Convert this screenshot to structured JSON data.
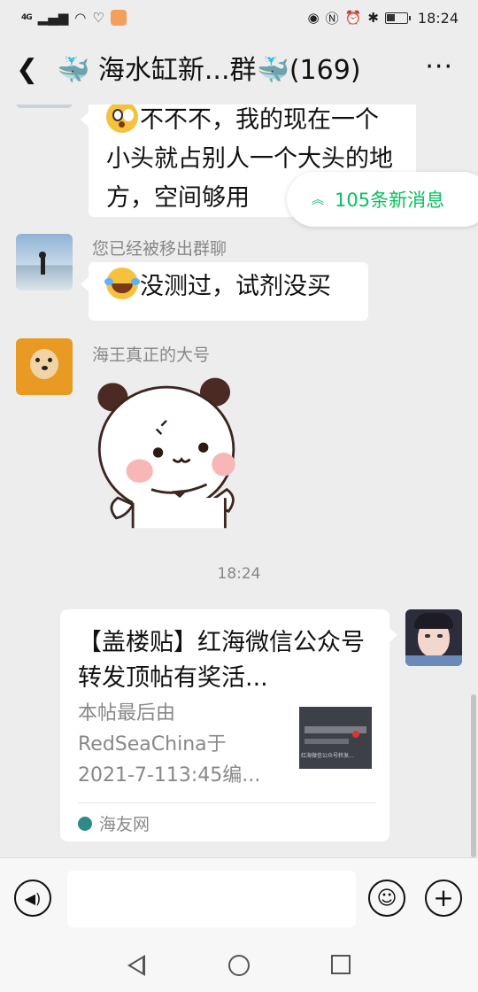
{
  "status_bar": {
    "network": "4G",
    "time": "18:24"
  },
  "nav": {
    "title": "🐳 海水缸新...群🐳(169)",
    "more": "···",
    "back_icon": "back-chevron-icon"
  },
  "messages": {
    "partial_text": "不不不，我的现在一个小头就占别人一个大头的地方，空间够用",
    "new_messages": "105条新消息",
    "msg2": {
      "sender": "您已经被移出群聊",
      "text": "没测过，试剂没买"
    },
    "msg3": {
      "sender": "海王真正的大号"
    },
    "timestamp": "18:24",
    "link": {
      "title": "【盖楼贴】红海微信公众号转发顶帖有奖活...",
      "desc": "本帖最后由RedSeaChina于2021-7-113:45编...",
      "thumb_caption": "红海微信公众号转发...",
      "source": "海友网"
    }
  },
  "input_bar": {
    "voice_icon": "voice-icon",
    "emoji_icon": "emoji-icon",
    "plus_icon": "plus-icon"
  },
  "colors": {
    "background": "#ededed",
    "accent_green": "#07c160",
    "bubble": "#ffffff"
  }
}
